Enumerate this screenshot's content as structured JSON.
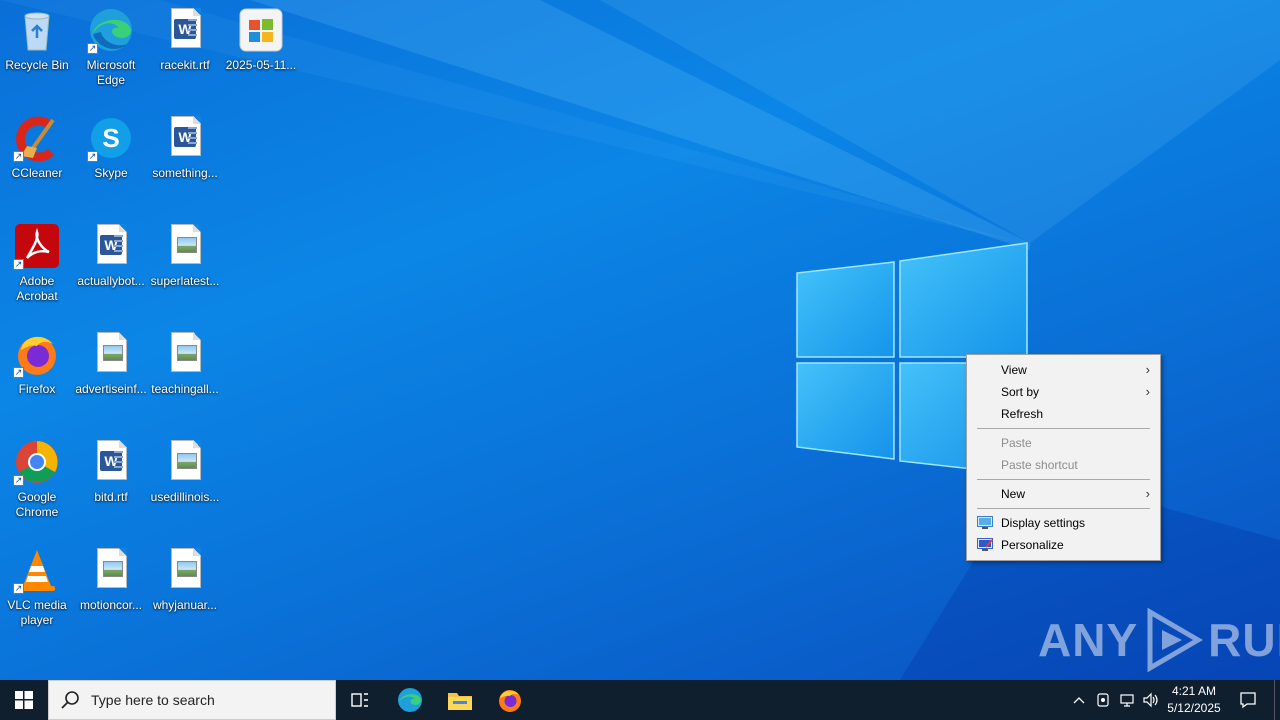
{
  "desktop": {
    "icons": [
      {
        "label": "Recycle Bin",
        "icon": "recycle-bin-icon"
      },
      {
        "label": "Microsoft Edge",
        "icon": "edge-icon"
      },
      {
        "label": "racekit.rtf",
        "icon": "word-document-icon"
      },
      {
        "label": "2025-05-11...",
        "icon": "office-icon"
      },
      {
        "label": "CCleaner",
        "icon": "ccleaner-icon"
      },
      {
        "label": "Skype",
        "icon": "skype-icon"
      },
      {
        "label": "something...",
        "icon": "word-document-icon"
      },
      {
        "label": "Adobe Acrobat",
        "icon": "acrobat-icon"
      },
      {
        "label": "actuallybot...",
        "icon": "word-document-icon"
      },
      {
        "label": "superlatest...",
        "icon": "image-file-icon"
      },
      {
        "label": "Firefox",
        "icon": "firefox-icon"
      },
      {
        "label": "advertiseinf...",
        "icon": "image-file-icon"
      },
      {
        "label": "teachingall...",
        "icon": "image-file-icon"
      },
      {
        "label": "Google Chrome",
        "icon": "chrome-icon"
      },
      {
        "label": "bitd.rtf",
        "icon": "word-document-icon"
      },
      {
        "label": "usedillinois...",
        "icon": "image-file-icon"
      },
      {
        "label": "VLC media player",
        "icon": "vlc-icon"
      },
      {
        "label": "motioncor...",
        "icon": "image-file-icon"
      },
      {
        "label": "whyjanuar...",
        "icon": "image-file-icon"
      }
    ]
  },
  "context_menu": {
    "view": "View",
    "sort_by": "Sort by",
    "refresh": "Refresh",
    "paste": "Paste",
    "paste_shortcut": "Paste shortcut",
    "new": "New",
    "display_settings": "Display settings",
    "personalize": "Personalize"
  },
  "watermark": {
    "text": "ANY",
    "text2": "RUN"
  },
  "taskbar": {
    "search_placeholder": "Type here to search",
    "time": "4:21 AM",
    "date": "5/12/2025"
  },
  "colors": {
    "taskbar": "#0f1f2e",
    "menu_bg": "#f2f2f2",
    "wallpaper": "#0b86e6"
  }
}
